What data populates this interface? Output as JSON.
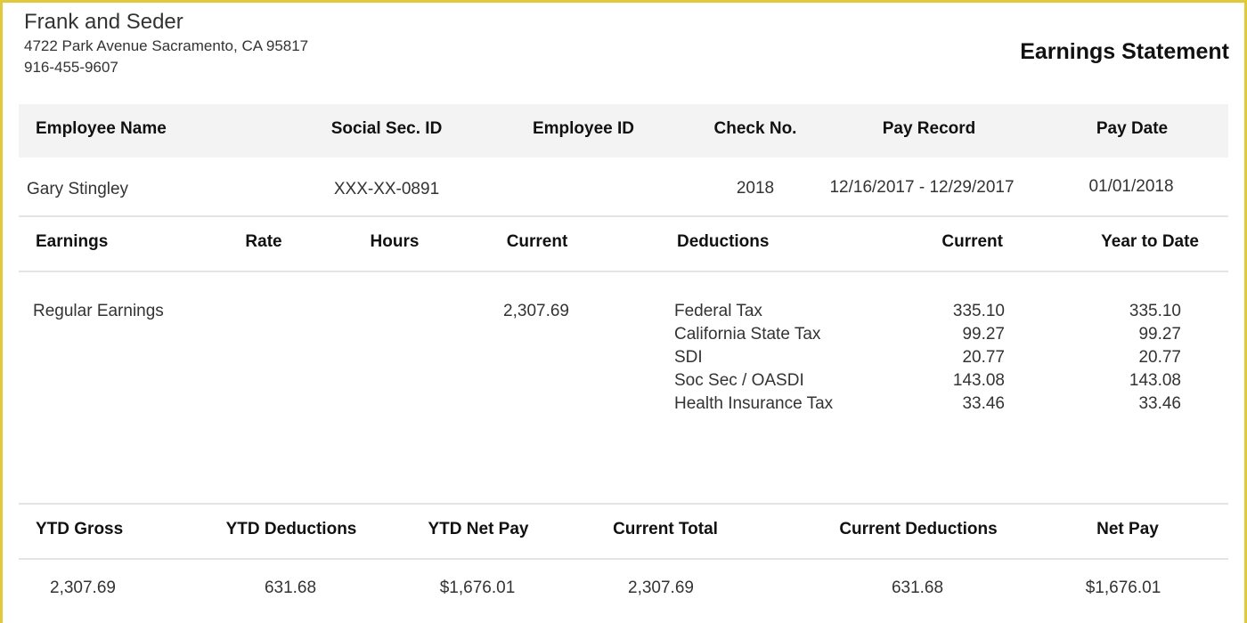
{
  "company": {
    "name": "Frank and Seder",
    "address": "4722 Park Avenue Sacramento, CA 95817",
    "phone": "916-455-9607"
  },
  "document_title": "Earnings Statement",
  "employee_header": {
    "name": "Employee Name",
    "ssn": "Social Sec. ID",
    "id": "Employee ID",
    "check": "Check No.",
    "record": "Pay Record",
    "date": "Pay Date"
  },
  "employee": {
    "name": "Gary Stingley",
    "ssn": "XXX-XX-0891",
    "id": "",
    "check": "2018",
    "record": "12/16/2017 - 12/29/2017",
    "date": "01/01/2018"
  },
  "earnings_header": {
    "earnings": "Earnings",
    "rate": "Rate",
    "hours": "Hours",
    "current": "Current",
    "deductions": "Deductions",
    "ded_current": "Current",
    "ytd": "Year to Date"
  },
  "earnings": {
    "label": "Regular Earnings",
    "rate": "",
    "hours": "",
    "current": "2,307.69"
  },
  "deductions": [
    {
      "label": "Federal Tax",
      "current": "335.10",
      "ytd": "335.10"
    },
    {
      "label": "California State Tax",
      "current": "99.27",
      "ytd": "99.27"
    },
    {
      "label": "SDI",
      "current": "20.77",
      "ytd": "20.77"
    },
    {
      "label": "Soc Sec / OASDI",
      "current": "143.08",
      "ytd": "143.08"
    },
    {
      "label": "Health Insurance Tax",
      "current": "33.46",
      "ytd": "33.46"
    }
  ],
  "summary_header": {
    "ytd_gross": "YTD Gross",
    "ytd_deductions": "YTD Deductions",
    "ytd_net": "YTD Net Pay",
    "current_total": "Current Total",
    "current_deductions": "Current Deductions",
    "net_pay": "Net Pay"
  },
  "summary": {
    "ytd_gross": "2,307.69",
    "ytd_deductions": "631.68",
    "ytd_net": "$1,676.01",
    "current_total": "2,307.69",
    "current_deductions": "631.68",
    "net_pay": "$1,676.01"
  },
  "colors": {
    "frame": "#e2c93a",
    "header_band": "#f3f3f3"
  }
}
